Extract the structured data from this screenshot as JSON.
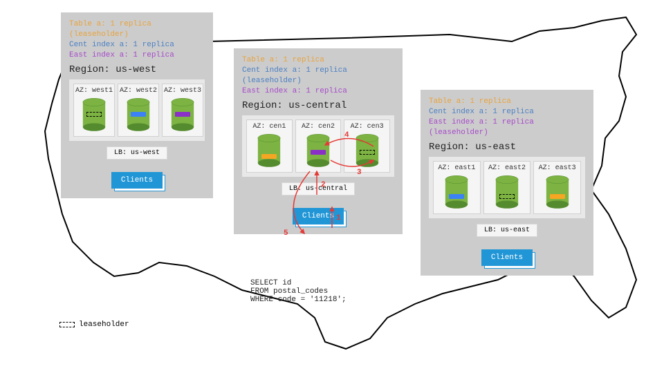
{
  "legend": {
    "label": "leaseholder"
  },
  "sql": "SELECT id\nFROM postal_codes\nWHERE code = '11218';",
  "regions": {
    "west": {
      "info": {
        "table": "Table a: 1 replica (leaseholder)",
        "cent": "Cent index a: 1 replica",
        "east": "East index a: 1 replica"
      },
      "title": "Region: us-west",
      "az": [
        "AZ: west1",
        "AZ: west2",
        "AZ: west3"
      ],
      "lb": "LB: us-west",
      "clients": "Clients"
    },
    "central": {
      "info": {
        "table": "Table a: 1 replica",
        "cent": "Cent index a: 1 replica (leaseholder)",
        "east": "East index a: 1 replica"
      },
      "title": "Region: us-central",
      "az": [
        "AZ: cen1",
        "AZ: cen2",
        "AZ: cen3"
      ],
      "lb": "LB: us-central",
      "clients": "Clients"
    },
    "east": {
      "info": {
        "table": "Table a: 1 replica",
        "cent": "Cent index a: 1 replica",
        "east": "East index a: 1 replica (leaseholder)"
      },
      "title": "Region: us-east",
      "az": [
        "AZ: east1",
        "AZ: east2",
        "AZ: east3"
      ],
      "lb": "LB: us-east",
      "clients": "Clients"
    }
  },
  "steps": {
    "s1": "1",
    "s2": "2",
    "s3": "3",
    "s4": "4",
    "s5": "5"
  }
}
